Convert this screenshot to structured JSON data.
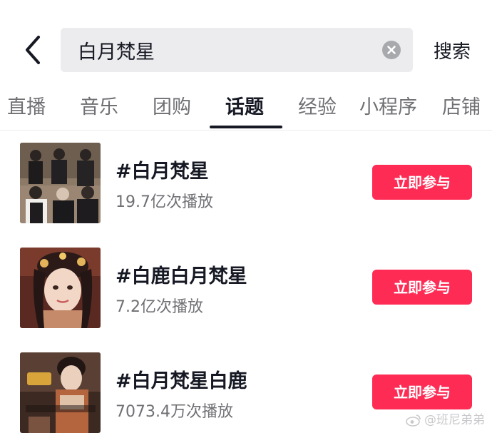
{
  "search": {
    "query": "白月梵星",
    "submit_label": "搜索"
  },
  "tabs": [
    {
      "label": "直播",
      "active": false
    },
    {
      "label": "音乐",
      "active": false
    },
    {
      "label": "团购",
      "active": false
    },
    {
      "label": "话题",
      "active": true
    },
    {
      "label": "经验",
      "active": false
    },
    {
      "label": "小程序",
      "active": false
    },
    {
      "label": "店铺",
      "active": false
    }
  ],
  "topics": [
    {
      "title": "#白月梵星",
      "plays": "19.7亿次播放",
      "button": "立即参与"
    },
    {
      "title": "#白鹿白月梵星",
      "plays": "7.2亿次播放",
      "button": "立即参与"
    },
    {
      "title": "#白月梵星白鹿",
      "plays": "7073.4万次播放",
      "button": "立即参与"
    }
  ],
  "watermark": {
    "text": "@班尼弟弟"
  },
  "colors": {
    "accent": "#fe2c55",
    "text_primary": "#161823",
    "text_secondary": "#6f7074",
    "search_bg": "#ececee"
  }
}
